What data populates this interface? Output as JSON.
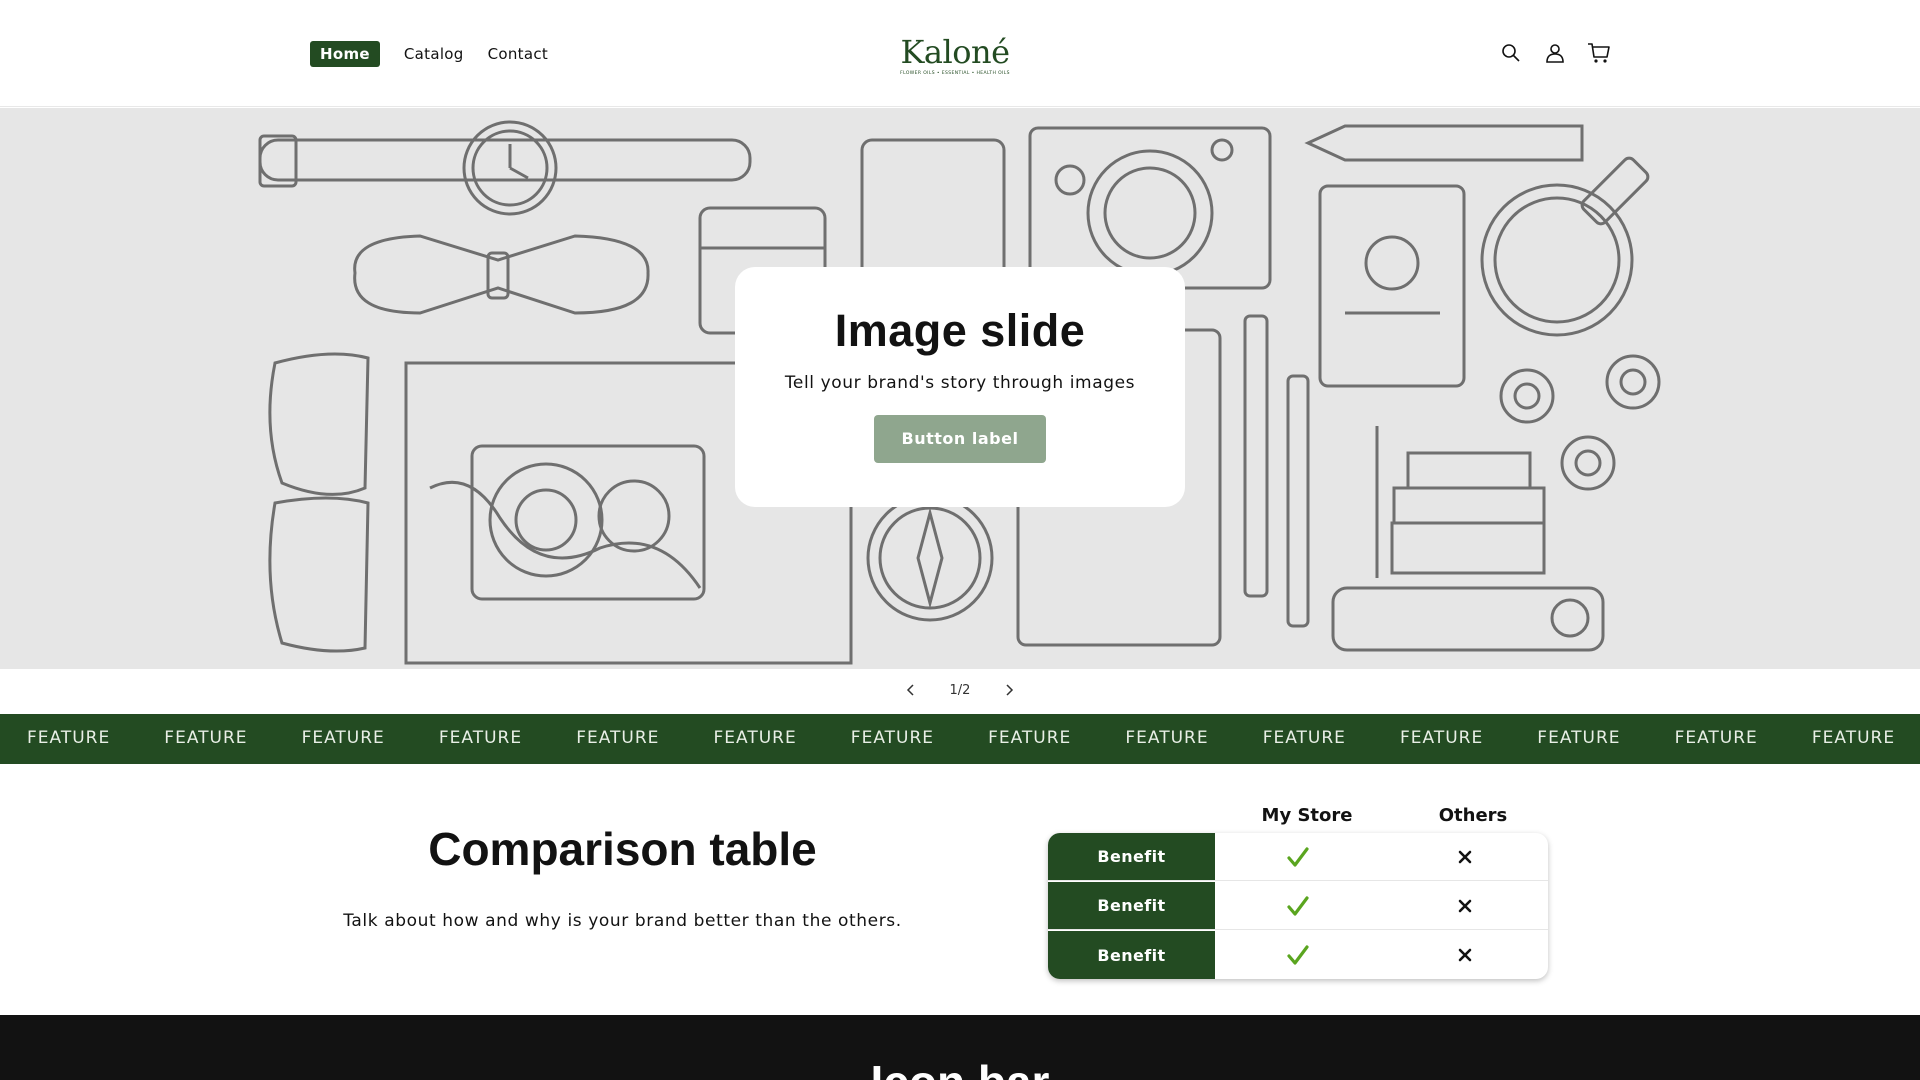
{
  "header": {
    "nav": [
      {
        "label": "Home",
        "active": true
      },
      {
        "label": "Catalog",
        "active": false
      },
      {
        "label": "Contact",
        "active": false
      }
    ],
    "logo": {
      "word": "Kaloné",
      "tagline": "FLOWER OILS • ESSENTIAL • HEALTH OILS"
    },
    "icons": [
      "search-icon",
      "account-icon",
      "cart-icon"
    ]
  },
  "hero": {
    "title": "Image slide",
    "subtitle": "Tell your brand's story through images",
    "button_label": "Button label",
    "slide_counter": "1/2"
  },
  "marquee": {
    "items": [
      "FEATURE",
      "FEATURE",
      "FEATURE",
      "FEATURE",
      "FEATURE",
      "FEATURE",
      "FEATURE",
      "FEATURE",
      "FEATURE",
      "FEATURE",
      "FEATURE",
      "FEATURE",
      "FEATURE",
      "FEATURE"
    ]
  },
  "comparison": {
    "title": "Comparison table",
    "text": "Talk about how and why is your brand better than the others.",
    "columns": [
      "My Store",
      "Others"
    ],
    "rows": [
      {
        "label": "Benefit",
        "mine": "check",
        "others": "cross"
      },
      {
        "label": "Benefit",
        "mine": "check",
        "others": "cross"
      },
      {
        "label": "Benefit",
        "mine": "check",
        "others": "cross"
      }
    ]
  },
  "icon_bar": {
    "title": "Icon bar"
  },
  "colors": {
    "brand_green": "#234b22",
    "button_green": "#8fa68e",
    "check_green": "#5aa51f",
    "dark": "#121212"
  }
}
